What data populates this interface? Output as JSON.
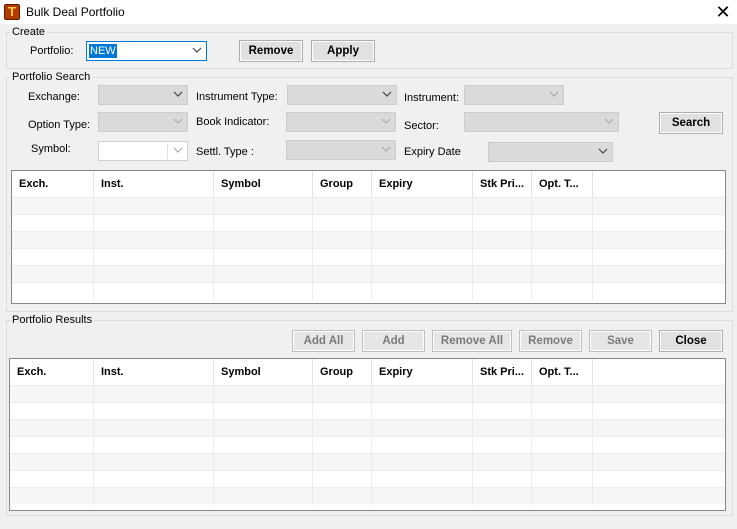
{
  "window": {
    "title": "Bulk Deal Portfolio",
    "close_glyph": "✕",
    "icon_letter": "T"
  },
  "create": {
    "group_label": "Create",
    "portfolio_label": "Portfolio:",
    "portfolio_value": "NEW",
    "remove_label": "Remove",
    "apply_label": "Apply"
  },
  "search": {
    "group_label": "Portfolio Search",
    "exchange_label": "Exchange:",
    "instrument_type_label": "Instrument Type:",
    "instrument_label": "Instrument:",
    "option_type_label": "Option Type:",
    "book_indicator_label": "Book Indicator:",
    "sector_label": "Sector:",
    "symbol_label": "Symbol:",
    "settl_type_label": "Settl. Type   :",
    "expiry_date_label": "Expiry Date",
    "search_button": "Search"
  },
  "columns": [
    "Exch.",
    "Inst.",
    "Symbol",
    "Group",
    "Expiry",
    "Stk Pri...",
    "Opt. T..."
  ],
  "results": {
    "group_label": "Portfolio Results",
    "add_all": "Add All",
    "add": "Add",
    "remove_all": "Remove All",
    "remove": "Remove",
    "save": "Save",
    "close": "Close"
  }
}
